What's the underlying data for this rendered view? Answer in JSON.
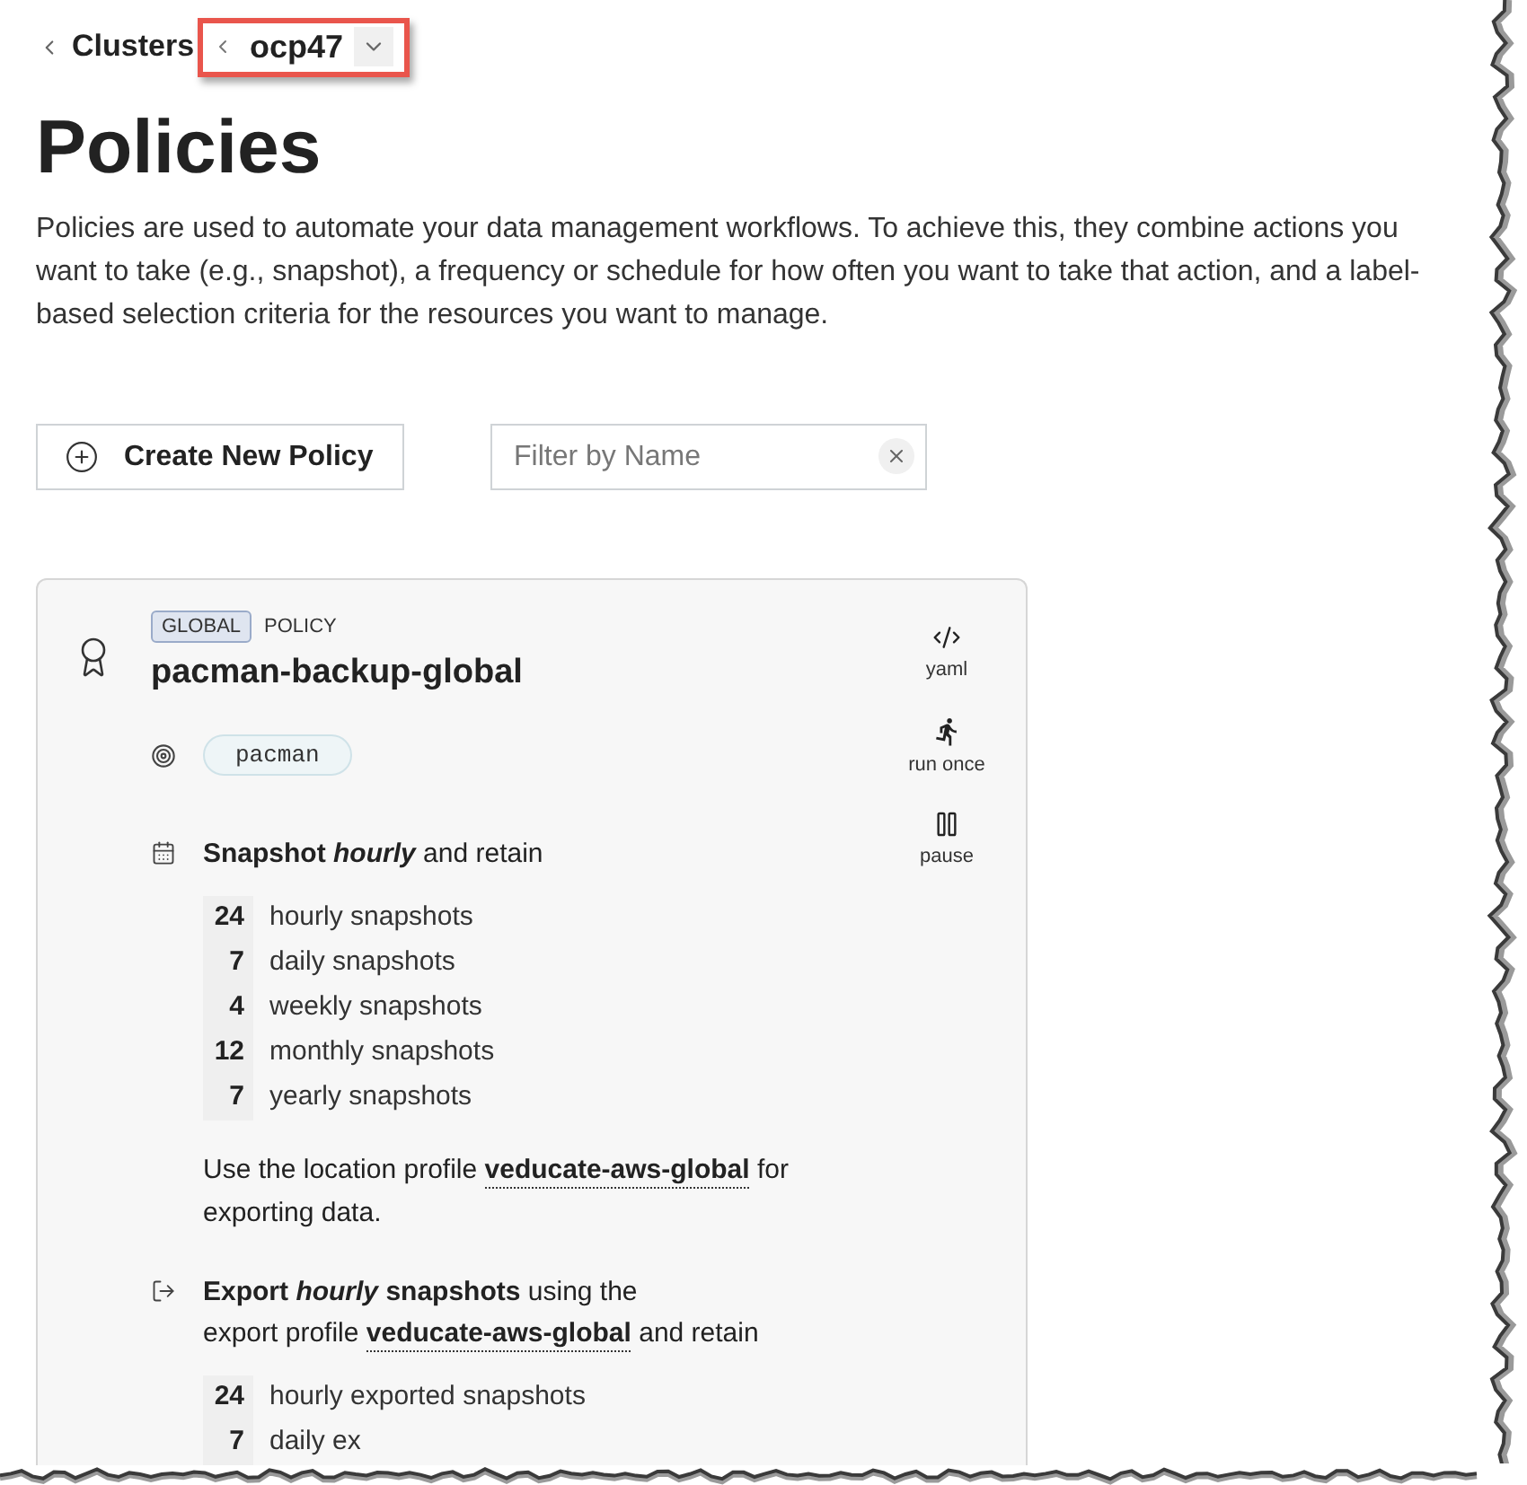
{
  "breadcrumb": {
    "parent": "Clusters",
    "current": {
      "label": "ocp47",
      "highlighted": true
    }
  },
  "page": {
    "title": "Policies",
    "description": "Policies are used to automate your data management workflows. To achieve this, they combine actions you want to take (e.g., snapshot), a frequency or schedule for how often you want to take that action, and a label-based selection criteria for the resources you want to manage."
  },
  "toolbar": {
    "create_button": "Create New Policy",
    "filter": {
      "placeholder": "Filter by Name"
    }
  },
  "policies": [
    {
      "scope_badge": "GLOBAL",
      "type_label": "POLICY",
      "name": "pacman-backup-global",
      "selector_labels": [
        "pacman"
      ],
      "actions": [
        {
          "kind": "yaml",
          "label": "yaml"
        },
        {
          "kind": "run_once",
          "label": "run once"
        },
        {
          "kind": "pause",
          "label": "pause"
        }
      ],
      "steps": [
        {
          "kind": "snapshot",
          "lines": [
            [
              {
                "kind": "term",
                "text": "Snapshot"
              },
              {
                "kind": "frequency",
                "text": "hourly"
              },
              {
                "kind": "text",
                "text": "and retain"
              }
            ]
          ],
          "retention": [
            {
              "count": "24",
              "label": "hourly snapshots"
            },
            {
              "count": "7",
              "label": "daily snapshots"
            },
            {
              "count": "4",
              "label": "weekly snapshots"
            },
            {
              "count": "12",
              "label": "monthly snapshots"
            },
            {
              "count": "7",
              "label": "yearly snapshots"
            }
          ],
          "note": [
            {
              "kind": "text",
              "text": "Use the location profile"
            },
            {
              "kind": "profile",
              "text": "veducate-aws-global"
            },
            {
              "kind": "text",
              "text": "for exporting data."
            }
          ]
        },
        {
          "kind": "export",
          "lines": [
            [
              {
                "kind": "term",
                "text": "Export"
              },
              {
                "kind": "frequency",
                "text": "hourly"
              },
              {
                "kind": "term",
                "text": "snapshots"
              },
              {
                "kind": "text",
                "text": "using the"
              }
            ],
            [
              {
                "kind": "text",
                "text": "export profile"
              },
              {
                "kind": "profile",
                "text": "veducate-aws-global"
              },
              {
                "kind": "text",
                "text": "and retain"
              }
            ]
          ],
          "retention": [
            {
              "count": "24",
              "label": "hourly exported snapshots"
            },
            {
              "count": "7",
              "label": "daily ex"
            }
          ]
        }
      ]
    }
  ]
}
